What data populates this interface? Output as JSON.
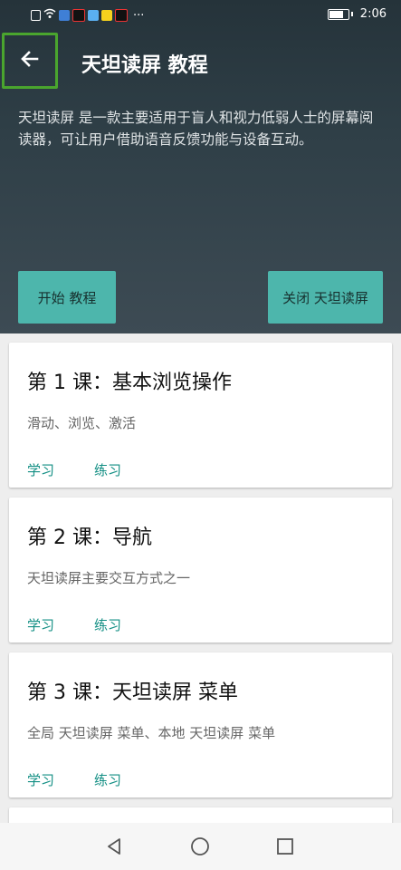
{
  "status_bar": {
    "time": "2:06",
    "icons": [
      "sim-alert-icon",
      "wifi-icon",
      "shield-app-icon",
      "tiktok-icon",
      "app-icon",
      "yy-app-icon",
      "tiktok-icon"
    ],
    "more": "···"
  },
  "toolbar": {
    "title": "天坦读屏 教程"
  },
  "intro": {
    "description": "天坦读屏 是一款主要适用于盲人和视力低弱人士的屏幕阅读器，可让用户借助语音反馈功能与设备互动。",
    "start_label": "开始 教程",
    "close_label": "关闭 天坦读屏"
  },
  "lessons": [
    {
      "title": "第 1 课：基本浏览操作",
      "subtitle": "滑动、浏览、激活",
      "learn": "学习",
      "practice": "练习"
    },
    {
      "title": "第 2 课：导航",
      "subtitle": "天坦读屏主要交互方式之一",
      "learn": "学习",
      "practice": "练习"
    },
    {
      "title": "第 3 课：天坦读屏 菜单",
      "subtitle": "全局 天坦读屏 菜单、本地 天坦读屏 菜单",
      "learn": "学习",
      "practice": "练习"
    }
  ],
  "colors": {
    "accent": "#4db6ac",
    "link": "#138f84",
    "focus": "#4aa52e",
    "header": "#2f3f47"
  }
}
